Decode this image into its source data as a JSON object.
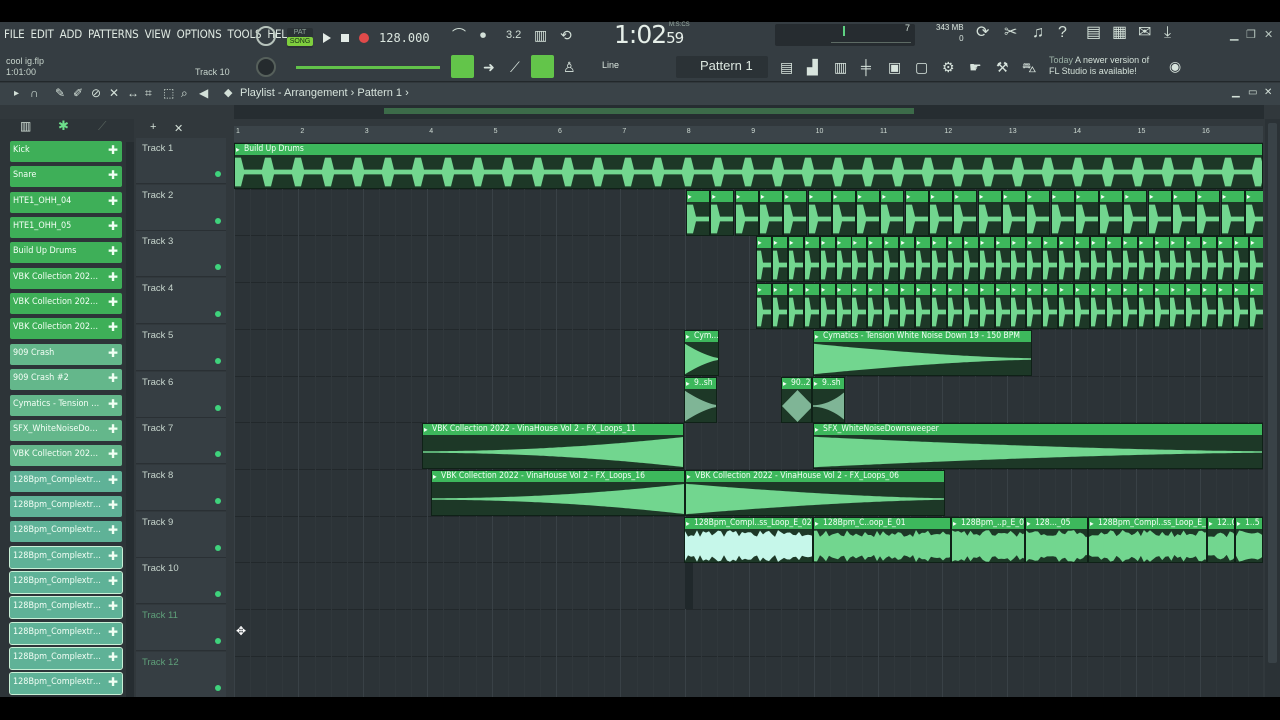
{
  "menu": [
    "FILE",
    "EDIT",
    "ADD",
    "PATTERNS",
    "VIEW",
    "OPTIONS",
    "TOOLS",
    "HELP"
  ],
  "project": {
    "file": "cool ig.flp",
    "time": "1:01:00",
    "track": "Track 10"
  },
  "transport": {
    "pat": "PAT",
    "song": "SONG",
    "tempo": "128.000",
    "time": "1:02",
    "time_small": "59",
    "time_label": "M:S:CS"
  },
  "cpu": {
    "memory": "343 MB",
    "polyphony": "0",
    "cpu": "7"
  },
  "pattern": {
    "name": "Pattern 1",
    "snap": "Line"
  },
  "news": {
    "today": "Today",
    "message_1": "A newer version of",
    "message_2": "FL Studio is available!"
  },
  "playlist": {
    "title": "Playlist - Arrangement",
    "pattern": "Pattern 1"
  },
  "ruler": [
    "1",
    "2",
    "3",
    "4",
    "5",
    "6",
    "7",
    "8",
    "9",
    "10",
    "11",
    "12",
    "13",
    "14",
    "15",
    "16"
  ],
  "channels": [
    "Kick",
    "Snare",
    "HTE1_OHH_04",
    "HTE1_OHH_05",
    "Build Up Drums",
    "VBK Collection 2022 - ...",
    "VBK Collection 2022 - ...",
    "VBK Collection 2022 - ...",
    "909 Crash",
    "909 Crash #2",
    "Cymatics - Tension W...",
    "SFX_WhiteNoiseDown...",
    "VBK Collection 2022 - ...",
    "128Bpm_Complextro...",
    "128Bpm_Complextro...",
    "128Bpm_Complextro...",
    "128Bpm_Complextro...",
    "128Bpm_Complextro...",
    "128Bpm_Complextro...",
    "128Bpm_Complextro...",
    "128Bpm_Complextro...",
    "128Bpm_Complextro..."
  ],
  "tracks": [
    "Track 1",
    "Track 2",
    "Track 3",
    "Track 4",
    "Track 5",
    "Track 6",
    "Track 7",
    "Track 8",
    "Track 9",
    "Track 10",
    "Track 11",
    "Track 12"
  ],
  "clips": {
    "t1": "Build Up Drums",
    "t5a": "Cym...",
    "t5b": "Cymatics - Tension White Noise Down 19 - 150 BPM",
    "t6a": "9..sh",
    "t6b": "90..2",
    "t6c": "9..sh",
    "t7a": "VBK Collection 2022 - VinaHouse Vol 2 - FX_Loops_11",
    "t7b": "SFX_WhiteNoiseDownsweeper",
    "t8a": "VBK Collection 2022 - VinaHouse Vol 2 - FX_Loops_16",
    "t8b": "VBK Collection 2022 - VinaHouse Vol 2 - FX_Loops_06",
    "t9a": "128Bpm_Compl..ss_Loop_E_02",
    "t9b": "128Bpm_C..oop_E_01",
    "t9c": "128Bpm_..p_E_03",
    "t9d": "128..._05",
    "t9e": "128Bpm_Compl..ss_Loop_E_03",
    "t9f": "12..05",
    "t9g": "1..5"
  }
}
